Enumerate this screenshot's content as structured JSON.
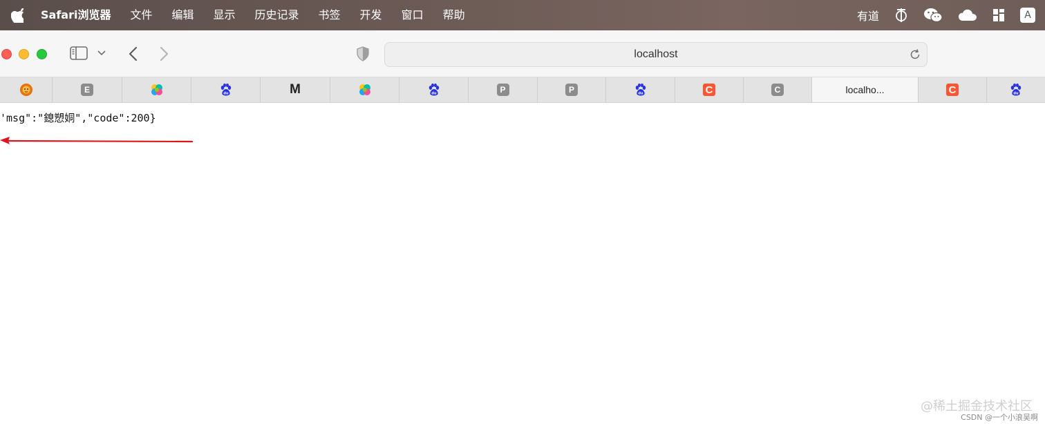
{
  "menubar": {
    "app_name": "Safari浏览器",
    "items": [
      "文件",
      "编辑",
      "显示",
      "历史记录",
      "书签",
      "开发",
      "窗口",
      "帮助"
    ],
    "tray": {
      "youdao": "有道",
      "input_method": "A"
    }
  },
  "toolbar": {
    "address": "localhost"
  },
  "tabs": {
    "labels": {
      "e": "E",
      "m": "M",
      "p1": "P",
      "p2": "P",
      "c1": "C",
      "c_gray": "C",
      "active": "localho...",
      "c2": "C"
    }
  },
  "page": {
    "response_text": "'msg\":\"鎴愬姛\",\"code\":200}"
  },
  "watermark": {
    "line1": "@稀土掘金技术社区",
    "line2": "CSDN @一个小浪吴啊"
  },
  "colors": {
    "arrow": "#e0141e",
    "csdn_orange": "#fc5531",
    "baidu_blue": "#2932e1"
  }
}
